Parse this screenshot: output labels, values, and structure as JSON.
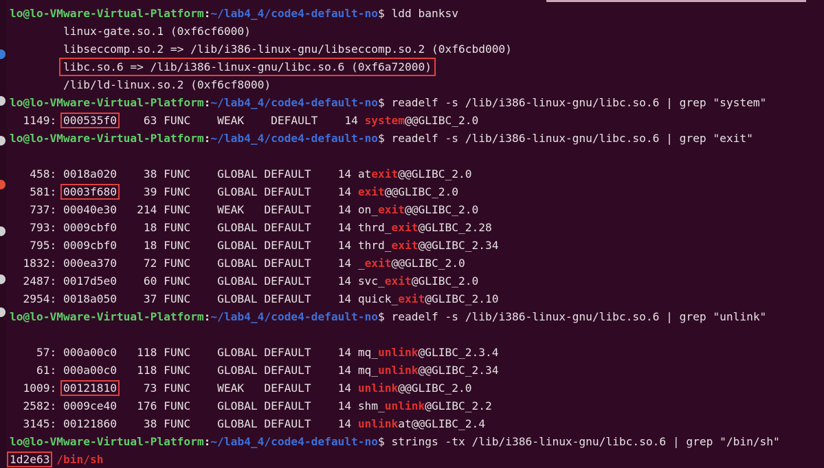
{
  "prompt": {
    "user": "lo@lo-VMware-Virtual-Platform",
    "sep": ":",
    "path": "~/lab4_4/code4-default-no",
    "symbol": "$ "
  },
  "blocks": [
    {
      "command": "ldd banksv",
      "output": [
        {
          "text": "        linux-gate.so.1 (0xf6cf6000)"
        },
        {
          "text": "        libseccomp.so.2 => /lib/i386-linux-gnu/libseccomp.so.2 (0xf6cbd000)"
        },
        {
          "text": "libc.so.6 => /lib/i386-linux-gnu/libc.so.6 (0xf6a72000)",
          "indent": "        ",
          "boxed": true
        },
        {
          "text": "        /lib/ld-linux.so.2 (0xf6cf8000)"
        }
      ]
    },
    {
      "command": "readelf -s /lib/i386-linux-gnu/libc.so.6 | grep \"system\"",
      "symbols": [
        {
          "num": "  1149: ",
          "addr": "000535f0",
          "size": "    63",
          "type": " FUNC    ",
          "bind": "WEAK   ",
          "vis": " DEFAULT   ",
          "ndx": " 14 ",
          "pre": "",
          "match": "system",
          "post": "@@GLIBC_2.0",
          "boxed": true
        }
      ]
    },
    {
      "command": "readelf -s /lib/i386-linux-gnu/libc.so.6 | grep \"exit\"",
      "blank": true,
      "symbols": [
        {
          "num": "   458: ",
          "addr": "0018a020",
          "size": "    38",
          "type": " FUNC    ",
          "bind": "GLOBAL",
          "vis": " DEFAULT   ",
          "ndx": " 14 ",
          "pre": "at",
          "match": "exit",
          "post": "@@GLIBC_2.0",
          "boxed": false
        },
        {
          "num": "   581: ",
          "addr": "0003f680",
          "size": "    39",
          "type": " FUNC    ",
          "bind": "GLOBAL",
          "vis": " DEFAULT   ",
          "ndx": " 14 ",
          "pre": "",
          "match": "exit",
          "post": "@@GLIBC_2.0",
          "boxed": true
        },
        {
          "num": "   737: ",
          "addr": "00040e30",
          "size": "   214",
          "type": " FUNC    ",
          "bind": "WEAK  ",
          "vis": " DEFAULT   ",
          "ndx": " 14 ",
          "pre": "on_",
          "match": "exit",
          "post": "@@GLIBC_2.0",
          "boxed": false
        },
        {
          "num": "   793: ",
          "addr": "0009cbf0",
          "size": "    18",
          "type": " FUNC    ",
          "bind": "GLOBAL",
          "vis": " DEFAULT   ",
          "ndx": " 14 ",
          "pre": "thrd_",
          "match": "exit",
          "post": "@GLIBC_2.28",
          "boxed": false
        },
        {
          "num": "   795: ",
          "addr": "0009cbf0",
          "size": "    18",
          "type": " FUNC    ",
          "bind": "GLOBAL",
          "vis": " DEFAULT   ",
          "ndx": " 14 ",
          "pre": "thrd_",
          "match": "exit",
          "post": "@@GLIBC_2.34",
          "boxed": false
        },
        {
          "num": "  1832: ",
          "addr": "000ea370",
          "size": "    72",
          "type": " FUNC    ",
          "bind": "GLOBAL",
          "vis": " DEFAULT   ",
          "ndx": " 14 ",
          "pre": "_",
          "match": "exit",
          "post": "@@GLIBC_2.0",
          "boxed": false
        },
        {
          "num": "  2487: ",
          "addr": "0017d5e0",
          "size": "    60",
          "type": " FUNC    ",
          "bind": "GLOBAL",
          "vis": " DEFAULT   ",
          "ndx": " 14 ",
          "pre": "svc_",
          "match": "exit",
          "post": "@GLIBC_2.0",
          "boxed": false
        },
        {
          "num": "  2954: ",
          "addr": "0018a050",
          "size": "    37",
          "type": " FUNC    ",
          "bind": "GLOBAL",
          "vis": " DEFAULT   ",
          "ndx": " 14 ",
          "pre": "quick_",
          "match": "exit",
          "post": "@GLIBC_2.10",
          "boxed": false
        }
      ]
    },
    {
      "command": "readelf -s /lib/i386-linux-gnu/libc.so.6 | grep \"unlink\"",
      "blank": true,
      "symbols": [
        {
          "num": "    57: ",
          "addr": "000a00c0",
          "size": "   118",
          "type": " FUNC    ",
          "bind": "GLOBAL",
          "vis": " DEFAULT   ",
          "ndx": " 14 ",
          "pre": "mq_",
          "match": "unlink",
          "post": "@GLIBC_2.3.4",
          "boxed": false
        },
        {
          "num": "    61: ",
          "addr": "000a00c0",
          "size": "   118",
          "type": " FUNC    ",
          "bind": "GLOBAL",
          "vis": " DEFAULT   ",
          "ndx": " 14 ",
          "pre": "mq_",
          "match": "unlink",
          "post": "@@GLIBC_2.34",
          "boxed": false
        },
        {
          "num": "  1009: ",
          "addr": "00121810",
          "size": "    73",
          "type": " FUNC    ",
          "bind": "WEAK  ",
          "vis": " DEFAULT   ",
          "ndx": " 14 ",
          "pre": "",
          "match": "unlink",
          "post": "@@GLIBC_2.0",
          "boxed": true
        },
        {
          "num": "  2582: ",
          "addr": "0009ce40",
          "size": "   176",
          "type": " FUNC    ",
          "bind": "GLOBAL",
          "vis": " DEFAULT   ",
          "ndx": " 14 ",
          "pre": "shm_",
          "match": "unlink",
          "post": "@GLIBC_2.2",
          "boxed": false
        },
        {
          "num": "  3145: ",
          "addr": "00121860",
          "size": "    38",
          "type": " FUNC    ",
          "bind": "GLOBAL",
          "vis": " DEFAULT   ",
          "ndx": " 14 ",
          "pre": "",
          "match": "unlink",
          "post": "at@@GLIBC_2.4",
          "boxed": false
        }
      ]
    },
    {
      "command": "strings -tx /lib/i386-linux-gnu/libc.so.6 | grep \"/bin/sh\"",
      "strings": [
        {
          "offset": "1d2e63",
          "match": "/bin/sh",
          "boxed": true
        }
      ]
    }
  ],
  "colors": {
    "background": "#300a24",
    "prompt_user": "#5fd068",
    "prompt_path": "#3d6fd9",
    "match": "#e0322e",
    "annotation_box": "#e2413d"
  }
}
